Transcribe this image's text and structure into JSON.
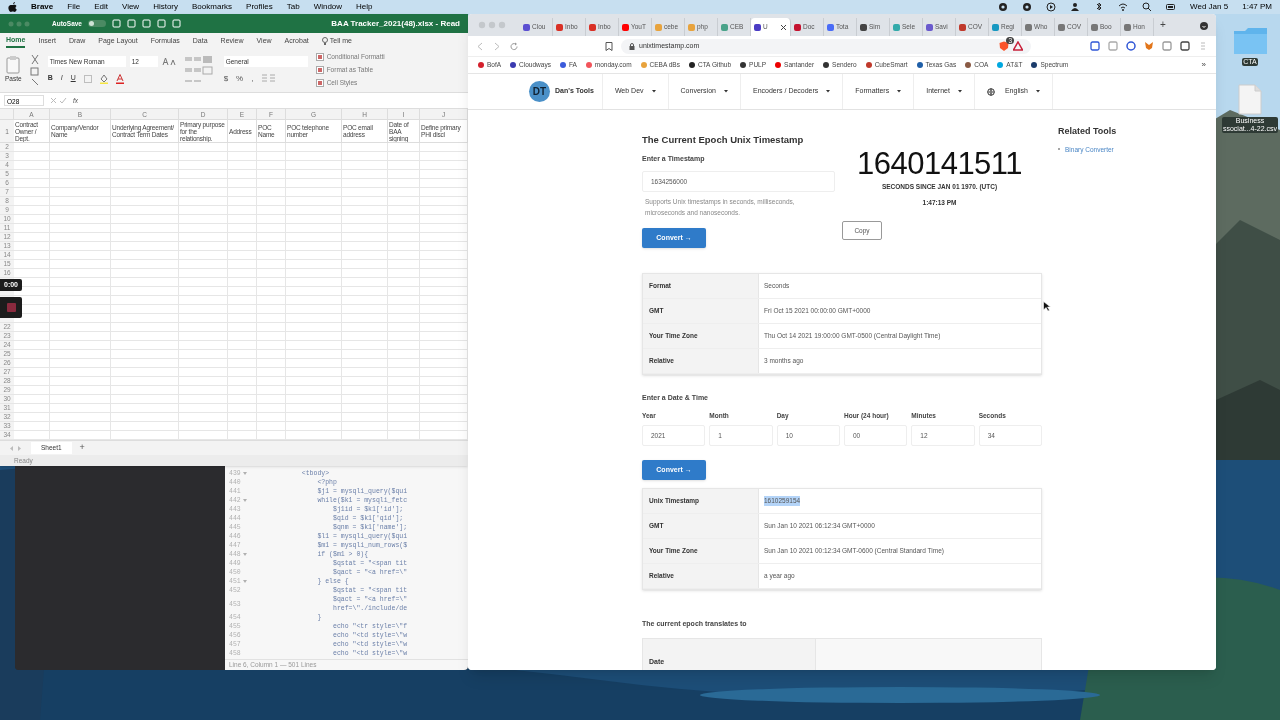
{
  "menubar": {
    "app": "Brave",
    "items": [
      "File",
      "Edit",
      "View",
      "History",
      "Bookmarks",
      "Profiles",
      "Tab",
      "Window",
      "Help"
    ],
    "date": "Wed Jan 5",
    "time": "1:47 PM"
  },
  "desktop": {
    "items": [
      {
        "kind": "folder",
        "label": "CTA"
      },
      {
        "kind": "file",
        "label": "Business\nssociat...4-22.csv"
      }
    ]
  },
  "recorder": {
    "elapsed": "0:00"
  },
  "excel": {
    "autosave": "AutoSave",
    "autosave_on": false,
    "title": "BAA Tracker_2021(48).xlsx  -  Read",
    "tabs": [
      {
        "label": "Home",
        "selected": true
      },
      {
        "label": "Insert",
        "selected": false
      },
      {
        "label": "Draw",
        "selected": false
      },
      {
        "label": "Page Layout",
        "selected": false
      },
      {
        "label": "Formulas",
        "selected": false
      },
      {
        "label": "Data",
        "selected": false
      },
      {
        "label": "Review",
        "selected": false
      },
      {
        "label": "View",
        "selected": false
      },
      {
        "label": "Acrobat",
        "selected": false
      }
    ],
    "tell_me": "Tell me",
    "paste": "Paste",
    "font": "Times New Roman",
    "size": "12",
    "format_buttons": [
      "B",
      "I",
      "U"
    ],
    "number_format": "General",
    "number_buttons": [
      "$",
      "%",
      ","
    ],
    "styles": [
      "Conditional Formatti",
      "Format as Table",
      "Cell Styles"
    ],
    "name_box": "O28",
    "fx": "fx",
    "columns": [
      {
        "letter": "A",
        "header": "Contract Owner / Dept."
      },
      {
        "letter": "B",
        "header": "Company/Vendor Name"
      },
      {
        "letter": "C",
        "header": "Underlying Agreement/ Contract Term Dates"
      },
      {
        "letter": "D",
        "header": "Primary purpose for the relationship."
      },
      {
        "letter": "E",
        "header": "Address"
      },
      {
        "letter": "F",
        "header": "POC Name"
      },
      {
        "letter": "G",
        "header": "POC telephone number"
      },
      {
        "letter": "H",
        "header": "POC email address"
      },
      {
        "letter": "I",
        "header": "Date of BAA signing"
      },
      {
        "letter": "J",
        "header": "Define primary PHI discl"
      }
    ],
    "row_one": "1",
    "rows_upper": [
      "2",
      "3",
      "4",
      "5",
      "6",
      "7",
      "8",
      "9",
      "10",
      "11",
      "12",
      "13",
      "14",
      "15",
      "16"
    ],
    "rows_lower": [
      "22",
      "23",
      "24",
      "25",
      "26",
      "27",
      "28",
      "29",
      "30",
      "31",
      "32",
      "33",
      "34"
    ],
    "sheets": [
      {
        "label": "Sheet1",
        "selected": true
      }
    ],
    "add_sheet": "+",
    "status": "Ready"
  },
  "editor": {
    "lines": [
      {
        "n": "439",
        "fold": true,
        "text": "            <tbody>"
      },
      {
        "n": "440",
        "fold": false,
        "text": "                <?php"
      },
      {
        "n": "441",
        "fold": false,
        "text": "                $j1 = mysqli_query($qui"
      },
      {
        "n": "442",
        "fold": true,
        "text": "                while($k1 = mysqli_fetc"
      },
      {
        "n": "443",
        "fold": false,
        "text": "                    $j1id = $k1['id'];"
      },
      {
        "n": "444",
        "fold": false,
        "text": "                    $qid = $k1['qid'];"
      },
      {
        "n": "445",
        "fold": false,
        "text": "                    $qnm = $k1['name'];"
      },
      {
        "n": "446",
        "fold": false,
        "text": "                $l1 = mysqli_query($qui"
      },
      {
        "n": "447",
        "fold": false,
        "text": "                $m1 = mysqli_num_rows($"
      },
      {
        "n": "448",
        "fold": true,
        "text": "                if ($m1 > 0){"
      },
      {
        "n": "449",
        "fold": false,
        "text": "                    $qstat = \"<span tit"
      },
      {
        "n": "450",
        "fold": false,
        "text": "                    $qact = \"<a href=\\\""
      },
      {
        "n": "451",
        "fold": true,
        "text": "                } else {"
      },
      {
        "n": "452",
        "fold": false,
        "text": "                    $qstat = \"<span tit"
      },
      {
        "n": "453",
        "fold": false,
        "text": "                    $qact = \"<a href=\\\"\n                    href=\\\"./include/de"
      },
      {
        "n": "454",
        "fold": false,
        "text": "                }"
      },
      {
        "n": "455",
        "fold": false,
        "text": "                    echo \"<tr style=\\\"f"
      },
      {
        "n": "456",
        "fold": false,
        "text": "                    echo \"<td style=\\\"w"
      },
      {
        "n": "457",
        "fold": false,
        "text": "                    echo \"<td style=\\\"w"
      },
      {
        "n": "458",
        "fold": false,
        "text": "                    echo \"<td style=\\\"w"
      }
    ],
    "status": "Line 6, Column 1 — 501 Lines"
  },
  "browser": {
    "tabs": [
      {
        "label": "Clou",
        "selected": false,
        "color": "#5b4fd1"
      },
      {
        "label": "Inbo",
        "selected": false,
        "color": "#d93025"
      },
      {
        "label": "Inbo",
        "selected": false,
        "color": "#d93025"
      },
      {
        "label": "YouT",
        "selected": false,
        "color": "#ff0000"
      },
      {
        "label": "cebe",
        "selected": false,
        "color": "#e8a33d"
      },
      {
        "label": "php",
        "selected": false,
        "color": "#e8a33d"
      },
      {
        "label": "CEB",
        "selected": false,
        "color": "#4aa38a"
      },
      {
        "label": "U",
        "selected": true,
        "color": "#4b3cc4"
      },
      {
        "label": "Doc",
        "selected": false,
        "color": "#c4122f"
      },
      {
        "label": "Tota",
        "selected": false,
        "color": "#4a6cf7"
      },
      {
        "label": "Sim",
        "selected": false,
        "color": "#444444"
      },
      {
        "label": "Sele",
        "selected": false,
        "color": "#33aaaa"
      },
      {
        "label": "Savi",
        "selected": false,
        "color": "#6a5acd"
      },
      {
        "label": "COV",
        "selected": false,
        "color": "#c0392b"
      },
      {
        "label": "Regi",
        "selected": false,
        "color": "#1798c1"
      },
      {
        "label": "Who",
        "selected": false,
        "color": "#777777"
      },
      {
        "label": "COV",
        "selected": false,
        "color": "#777777"
      },
      {
        "label": "Boo",
        "selected": false,
        "color": "#777777"
      },
      {
        "label": "Hon",
        "selected": false,
        "color": "#777777"
      }
    ],
    "new_tab": "+",
    "address": "unixtimestamp.com",
    "shield_count": "3",
    "bookmarks": [
      {
        "label": "BofA",
        "color": "#d4202c"
      },
      {
        "label": "Cloudways",
        "color": "#3a3ab0"
      },
      {
        "label": "FA",
        "color": "#3b5bdb"
      },
      {
        "label": "monday.com",
        "color": "#f2545b"
      },
      {
        "label": "CEBA dBs",
        "color": "#e8a33d"
      },
      {
        "label": "CTA Github",
        "color": "#222222"
      },
      {
        "label": "PULP",
        "color": "#333333"
      },
      {
        "label": "Santander",
        "color": "#ec0000"
      },
      {
        "label": "Sendero",
        "color": "#333333"
      },
      {
        "label": "CubeSmart",
        "color": "#c0392b"
      },
      {
        "label": "Texas Gas",
        "color": "#1f5fa8"
      },
      {
        "label": "COA",
        "color": "#8a5a44"
      },
      {
        "label": "AT&T",
        "color": "#00a8e0"
      },
      {
        "label": "Spectrum",
        "color": "#1b3c6b"
      }
    ],
    "more_bookmarks": "»",
    "site": {
      "logo": "DT",
      "brand": "Dan's Tools",
      "nav": [
        {
          "label": "Web Dev",
          "kind": "menu"
        },
        {
          "label": "Conversion",
          "kind": "menu"
        },
        {
          "label": "Encoders / Decoders",
          "kind": "menu"
        },
        {
          "label": "Formatters",
          "kind": "menu"
        },
        {
          "label": "Internet",
          "kind": "menu"
        },
        {
          "label": "English",
          "kind": "language"
        }
      ],
      "heading": "The Current Epoch Unix Timestamp",
      "input_label": "Enter a Timestamp",
      "input_value": "1634256000",
      "help": "Supports Unix timestamps in seconds, milliseconds, microseconds and nanoseconds.",
      "convert": "Convert →",
      "current": "1640141511",
      "current_caption": "SECONDS SINCE JAN 01 1970. (UTC)",
      "current_time": "1:47:13 PM",
      "copy": "Copy",
      "related_title": "Related Tools",
      "related": [
        "Binary Converter"
      ],
      "result1": [
        {
          "label": "Format",
          "value": "Seconds",
          "highlighted": false
        },
        {
          "label": "GMT",
          "value": "Fri Oct 15 2021 00:00:00 GMT+0000",
          "highlighted": false
        },
        {
          "label": "Your Time Zone",
          "value": "Thu Oct 14 2021 19:00:00 GMT-0500 (Central Daylight Time)",
          "highlighted": false
        },
        {
          "label": "Relative",
          "value": "3 months ago",
          "highlighted": false
        }
      ],
      "date_heading": "Enter a Date & Time",
      "date_fields": [
        {
          "label": "Year",
          "value": "2021"
        },
        {
          "label": "Month",
          "value": "1"
        },
        {
          "label": "Day",
          "value": "10"
        },
        {
          "label": "Hour (24 hour)",
          "value": "00"
        },
        {
          "label": "Minutes",
          "value": "12"
        },
        {
          "label": "Seconds",
          "value": "34"
        }
      ],
      "convert2": "Convert →",
      "result2": [
        {
          "label": "Unix Timestamp",
          "value": "1610259154",
          "highlighted": true
        },
        {
          "label": "GMT",
          "value": "Sun Jan 10 2021 06:12:34 GMT+0000",
          "highlighted": false
        },
        {
          "label": "Your Time Zone",
          "value": "Sun Jan 10 2021 00:12:34 GMT-0600 (Central Standard Time)",
          "highlighted": false
        },
        {
          "label": "Relative",
          "value": "a year ago",
          "highlighted": false
        }
      ],
      "translates": "The current epoch translates to",
      "table3_header": "Date"
    }
  }
}
